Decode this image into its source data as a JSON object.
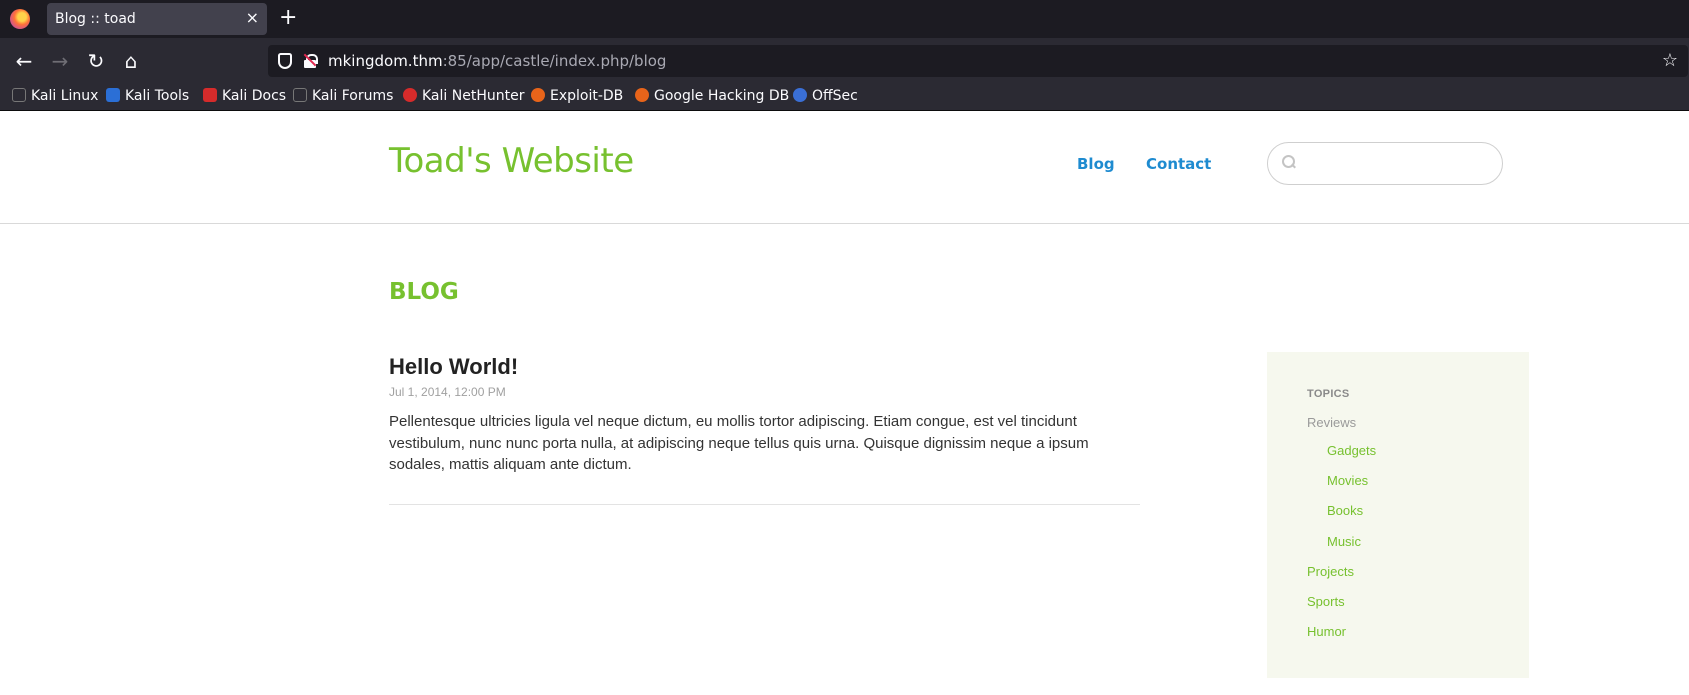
{
  "browser": {
    "tab_title": "Blog :: toad",
    "tab_close": "×",
    "new_tab": "+",
    "url_host": "mkingdom.thm",
    "url_rest": ":85/app/castle/index.php/blog",
    "nav": {
      "back": "←",
      "forward": "→",
      "reload": "↻",
      "home": "⌂",
      "bookmark": "☆"
    },
    "bookmarks": [
      {
        "label": "Kali Linux",
        "icon": "kali-dragon-icon",
        "color": "#1c1b22"
      },
      {
        "label": "Kali Tools",
        "icon": "kali-tools-icon",
        "color": "#2b6fd6"
      },
      {
        "label": "Kali Docs",
        "icon": "kali-docs-icon",
        "color": "#d62b2b"
      },
      {
        "label": "Kali Forums",
        "icon": "kali-forums-icon",
        "color": "#1c1b22"
      },
      {
        "label": "Kali NetHunter",
        "icon": "nethunter-icon",
        "color": "#d62b2b"
      },
      {
        "label": "Exploit-DB",
        "icon": "exploit-db-icon",
        "color": "#e8641a"
      },
      {
        "label": "Google Hacking DB",
        "icon": "ghdb-icon",
        "color": "#e8641a"
      },
      {
        "label": "OffSec",
        "icon": "offsec-icon",
        "color": "#3a6fd6"
      }
    ]
  },
  "site": {
    "title": "Toad's Website",
    "nav": [
      "Blog",
      "Contact"
    ],
    "search_placeholder": ""
  },
  "main": {
    "heading": "BLOG",
    "post": {
      "title": "Hello World!",
      "date": "Jul 1, 2014, 12:00 PM",
      "body": "Pellentesque ultricies ligula vel neque dictum, eu mollis tortor adipiscing. Etiam congue, est vel tincidunt vestibulum, nunc nunc porta nulla, at adipiscing neque tellus quis urna. Quisque dignissim neque a ipsum sodales, mattis aliquam ante dictum."
    }
  },
  "sidebar": {
    "heading": "TOPICS",
    "items": [
      "Reviews",
      "Gadgets",
      "Movies",
      "Books",
      "Music",
      "Projects",
      "Sports",
      "Humor"
    ]
  },
  "colors": {
    "accent": "#77c12f",
    "link": "#1e8bd0"
  }
}
